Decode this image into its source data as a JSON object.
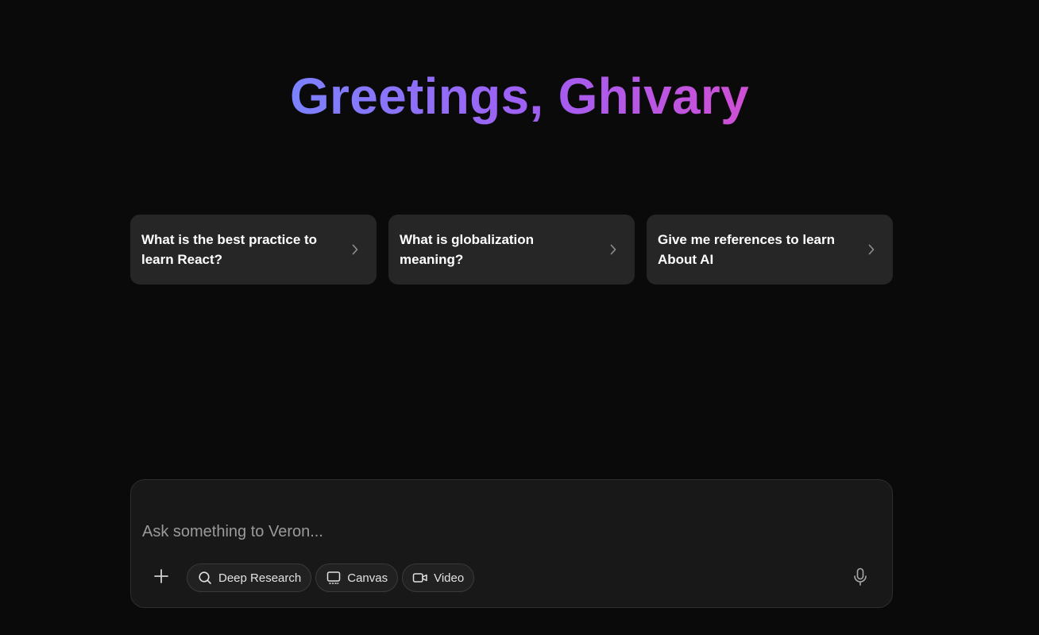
{
  "greeting": {
    "text": "Greetings, Ghivary"
  },
  "suggestions": [
    {
      "text": "What is the best practice to learn React?",
      "icon": "chevron-right-icon"
    },
    {
      "text": "What is globalization meaning?",
      "icon": "chevron-right-icon"
    },
    {
      "text": "Give me references to learn About AI",
      "icon": "chevron-right-icon"
    }
  ],
  "composer": {
    "placeholder": "Ask something to Veron...",
    "value": "",
    "add_icon": "plus-icon",
    "tools": [
      {
        "label": "Deep Research",
        "icon": "search-icon"
      },
      {
        "label": "Canvas",
        "icon": "canvas-icon"
      },
      {
        "label": "Video",
        "icon": "video-icon"
      }
    ],
    "mic_icon": "microphone-icon"
  },
  "colors": {
    "background": "#0a0a0b",
    "card": "#262626",
    "composer": "#181818",
    "gradient_start": "#7b82ff",
    "gradient_end": "#cf4fd4"
  }
}
